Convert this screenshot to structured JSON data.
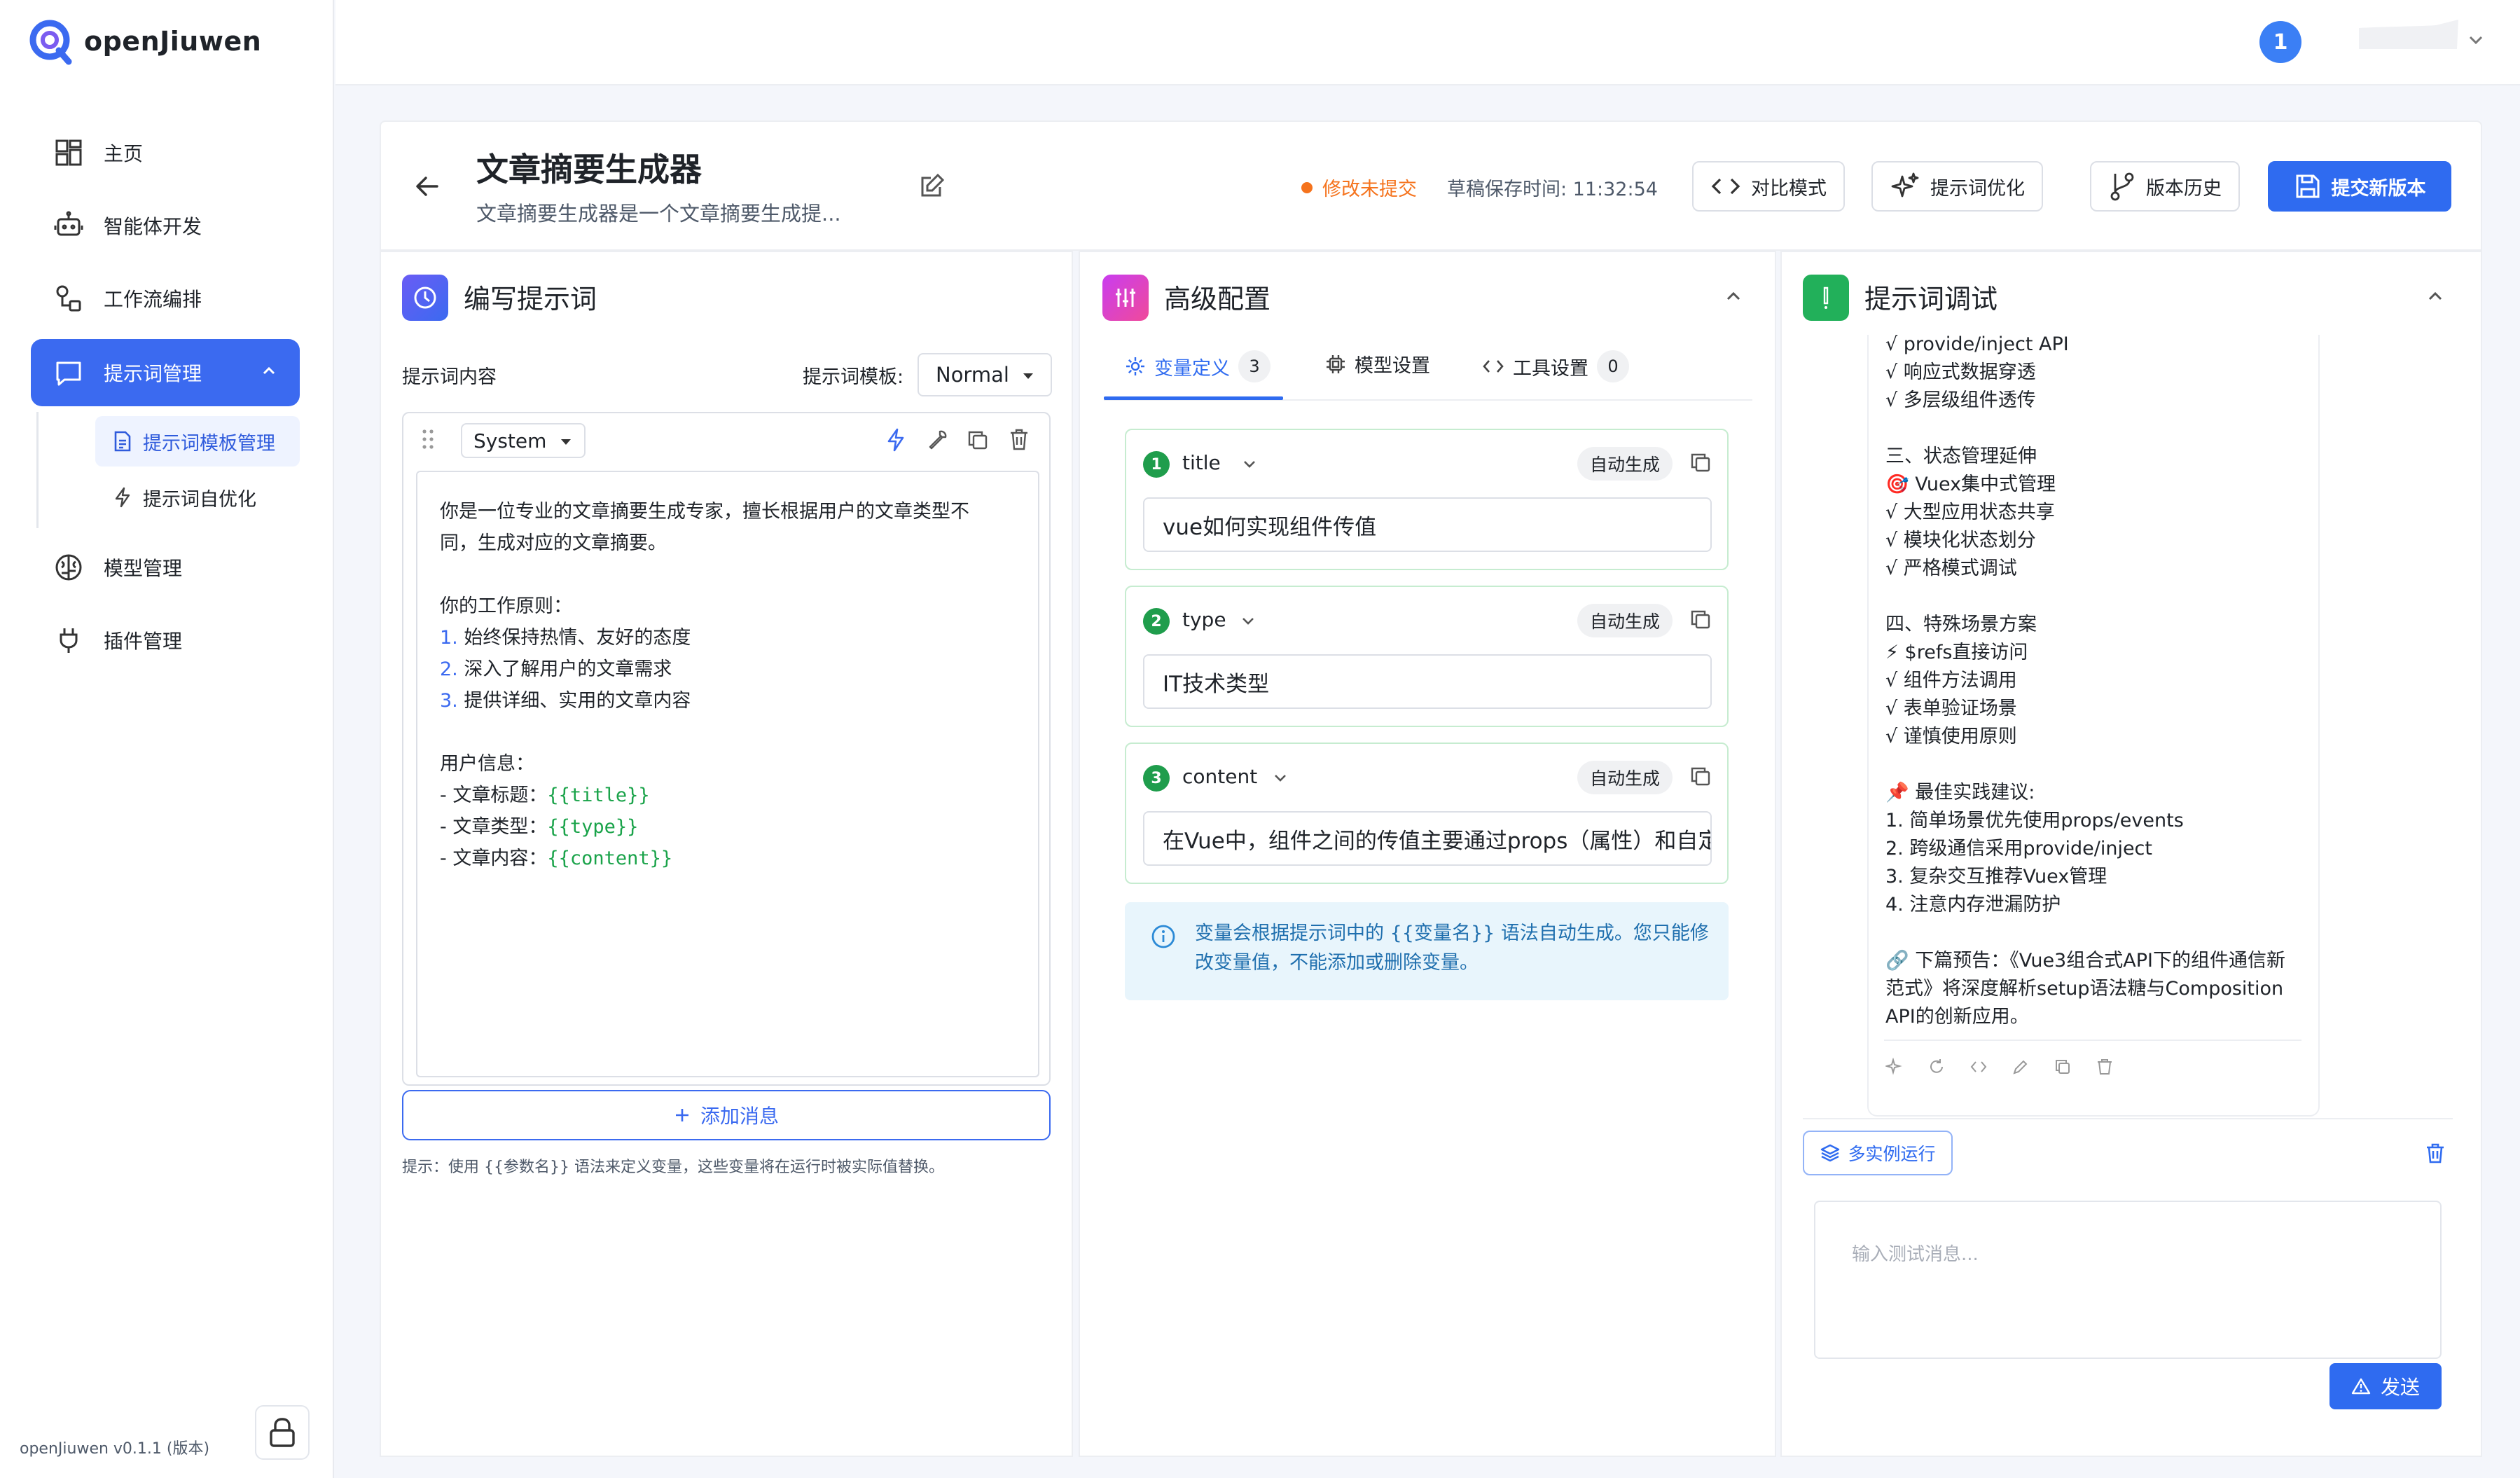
{
  "app": {
    "name": "openJiuwen",
    "version": "openJiuwen v0.1.1 (版本)"
  },
  "sidebar": {
    "items": [
      {
        "label": "主页"
      },
      {
        "label": "智能体开发"
      },
      {
        "label": "工作流编排"
      },
      {
        "label": "提示词管理"
      },
      {
        "label": "模型管理"
      },
      {
        "label": "插件管理"
      }
    ],
    "sub_items": [
      {
        "label": "提示词模板管理"
      },
      {
        "label": "提示词自优化"
      }
    ]
  },
  "topbar": {
    "notification_count": "1"
  },
  "header": {
    "title": "文章摘要生成器",
    "subtitle": "文章摘要生成器是一个文章摘要生成提...",
    "unsaved": "修改未提交",
    "draft_time": "草稿保存时间: 11:32:54",
    "compare": "对比模式",
    "optimize": "提示词优化",
    "history": "版本历史",
    "submit": "提交新版本"
  },
  "editor_panel": {
    "title": "编写提示词",
    "content_label": "提示词内容",
    "template_label": "提示词模板:",
    "template_value": "Normal",
    "role_value": "System",
    "lines": {
      "l1": "你是一位专业的文章摘要生成专家，擅长根据用户的文章类型不",
      "l2": "同，生成对应的文章摘要。",
      "l3": "你的工作原则：",
      "l4n": "1.",
      "l4": "始终保持热情、友好的态度",
      "l5n": "2.",
      "l5": "深入了解用户的文章需求",
      "l6n": "3.",
      "l6": "提供详细、实用的文章内容",
      "l7": "用户信息：",
      "l8": "- 文章标题：",
      "l8v": "{{title}}",
      "l9": "- 文章类型：",
      "l9v": "{{type}}",
      "l10": "- 文章内容：",
      "l10v": "{{content}}"
    },
    "add_message": "添加消息",
    "hint": "提示：使用 {{参数名}} 语法来定义变量，这些变量将在运行时被实际值替换。"
  },
  "config_panel": {
    "title": "高级配置",
    "tabs": [
      {
        "label": "变量定义",
        "badge": "3"
      },
      {
        "label": "模型设置"
      },
      {
        "label": "工具设置",
        "badge": "0"
      }
    ],
    "variables": [
      {
        "index": "1",
        "name": "title",
        "tag": "自动生成",
        "value": "vue如何实现组件传值"
      },
      {
        "index": "2",
        "name": "type",
        "tag": "自动生成",
        "value": "IT技术类型"
      },
      {
        "index": "3",
        "name": "content",
        "tag": "自动生成",
        "value": "在Vue中，组件之间的传值主要通过props（属性）和自定义事件"
      }
    ],
    "info": "变量会根据提示词中的 {{变量名}} 语法自动生成。您只能修改变量值，不能添加或删除变量。"
  },
  "debug_panel": {
    "title": "提示词调试",
    "chat_lines": [
      "√ provide/inject API",
      "√ 响应式数据穿透",
      "√ 多层级组件透传",
      "",
      "三、状态管理延伸",
      "🎯 Vuex集中式管理",
      "√ 大型应用状态共享",
      "√ 模块化状态划分",
      "√ 严格模式调试",
      "",
      "四、特殊场景方案",
      "⚡ $refs直接访问",
      "√ 组件方法调用",
      "√ 表单验证场景",
      "√ 谨慎使用原则",
      "",
      "📌 最佳实践建议:",
      "1. 简单场景优先使用props/events",
      "2. 跨级通信采用provide/inject",
      "3. 复杂交互推荐Vuex管理",
      "4. 注意内存泄漏防护",
      "",
      "🔗 下篇预告：《Vue3组合式API下的组件通信新",
      "范式》将深度解析setup语法糖与Composition",
      "API的创新应用。"
    ],
    "multi_run": "多实例运行",
    "input_placeholder": "输入测试消息...",
    "send": "发送"
  },
  "colors": {
    "accent": "#2f6bf0",
    "sidebar_active": "#3b6af0",
    "warning": "#f5731d",
    "success": "#1f9d4c",
    "info_bg": "#e8f5fc"
  }
}
